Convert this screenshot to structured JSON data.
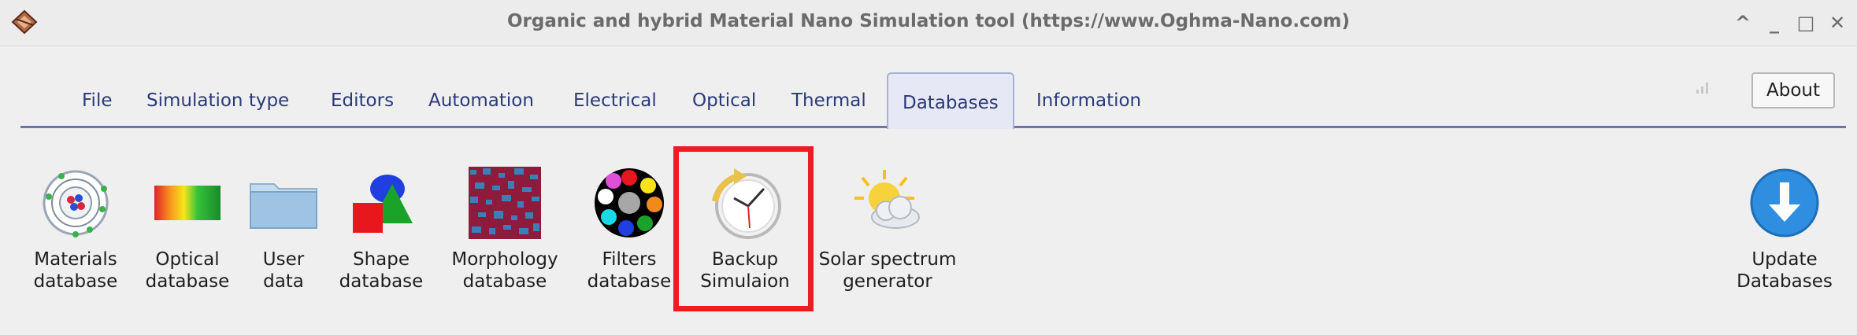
{
  "window": {
    "title": "Organic and hybrid Material Nano Simulation tool (https://www.Oghma-Nano.com)",
    "controls": [
      "^",
      "_",
      "□",
      "✕"
    ]
  },
  "tabs": [
    {
      "label": "File"
    },
    {
      "label": "Simulation type"
    },
    {
      "label": "Editors"
    },
    {
      "label": "Automation"
    },
    {
      "label": "Electrical"
    },
    {
      "label": "Optical"
    },
    {
      "label": "Thermal"
    },
    {
      "label": "Databases",
      "active": true
    },
    {
      "label": "Information"
    }
  ],
  "about_label": "About",
  "toolbar": {
    "materials": {
      "line1": "Materials",
      "line2": "database",
      "icon": "atom-icon"
    },
    "optical": {
      "line1": "Optical",
      "line2": "database",
      "icon": "spectrum-icon"
    },
    "user": {
      "line1": "User",
      "line2": "data",
      "icon": "folder-icon"
    },
    "shape": {
      "line1": "Shape",
      "line2": "database",
      "icon": "shapes-icon"
    },
    "morphology": {
      "line1": "Morphology",
      "line2": "database",
      "icon": "morphology-icon"
    },
    "filters": {
      "line1": "Filters",
      "line2": "database",
      "icon": "filters-icon"
    },
    "backup": {
      "line1": "Backup",
      "line2": "Simulaion",
      "icon": "clock-backup-icon"
    },
    "solar": {
      "line1": "Solar spectrum",
      "line2": "generator",
      "icon": "sun-cloud-icon"
    },
    "update": {
      "line1": "Update",
      "line2": "Databases",
      "icon": "download-arrow-icon"
    }
  },
  "colors": {
    "tab_text": "#2b3a77",
    "tab_underline": "#6c76a8",
    "highlight": "#ec1c24",
    "update_blue": "#2f8ee0"
  }
}
